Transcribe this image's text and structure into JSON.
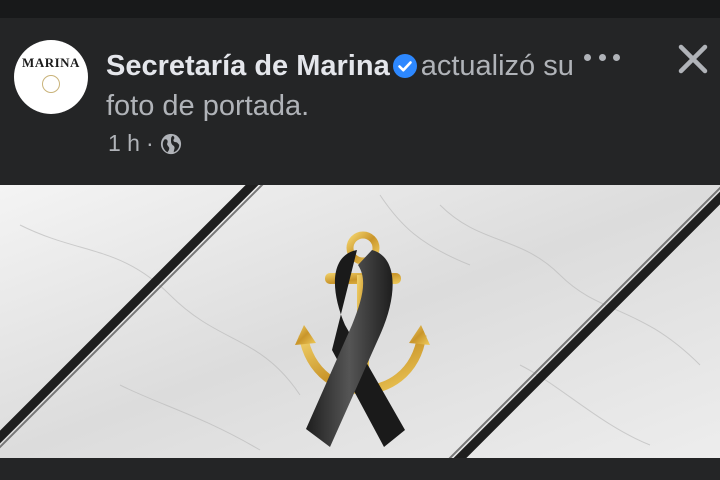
{
  "post": {
    "page_name": "Secretaría de Marina",
    "action_text": "actualizó su foto de portada.",
    "timestamp": "1 h",
    "separator": "·",
    "avatar_text": "MARINA",
    "verified_icon": "verified-badge-icon",
    "audience_icon": "globe-icon",
    "more_icon": "more-options-icon",
    "close_icon": "close-icon"
  },
  "cover_photo": {
    "subject": "mourning-ribbon-anchor",
    "ribbon_color": "#2b2b2b",
    "anchor_color": "#d4a93a",
    "background_color": "#e6e6e6"
  },
  "colors": {
    "background": "#242526",
    "text_primary": "#e4e6eb",
    "text_secondary": "#b0b3b8",
    "verified": "#2d88ff"
  }
}
